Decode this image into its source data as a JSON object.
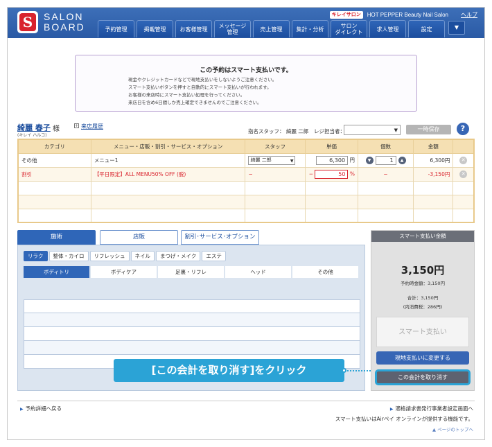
{
  "header": {
    "logo_line1": "SALON",
    "logo_line2": "BOARD",
    "logo_mark": "S",
    "brand_badge": "キレイサロン",
    "brand_name": "HOT PEPPER Beauty Nail Salon",
    "help": "ヘルプ",
    "nav": [
      "予約管理",
      "掲載管理",
      "お客様管理",
      "メッセージ\n管理",
      "売上管理",
      "集計・分析",
      "サロン\nダイレクト",
      "求人管理",
      "設定"
    ],
    "menu_icon": "▼"
  },
  "notice": {
    "title": "この予約はスマート支払いです。",
    "lines": [
      "現金やクレジットカードなどで現地支払いをしないようご注意ください。",
      "スマート支払いボタンを押すと自動的にスマート支払いが行われます。",
      "お客様の来店時にスマート支払い処理を行ってください。",
      "来店日を含め6日間しか売上確定できませんのでご注意ください。"
    ]
  },
  "customer": {
    "name": "綺麗 春子",
    "honorific": "様",
    "kana": "(キレイ ハルコ)",
    "history_link": "来店履歴",
    "staff_label": "指名スタッフ： 綺麗 二郎",
    "register_label": "レジ担当者：",
    "register_value": "",
    "hold_button": "一時保存",
    "help_icon": "?"
  },
  "table": {
    "headers": [
      "カテゴリ",
      "メニュー・店販・割引・サービス・オプション",
      "スタッフ",
      "単価",
      "個数",
      "金額",
      ""
    ],
    "rows": [
      {
        "category": "その他",
        "item": "メニュー1",
        "staff": "綺麗 二郎",
        "price": "6,300",
        "price_unit": "円",
        "qty": "1",
        "amount": "6,300円"
      },
      {
        "category": "割引",
        "item": "【平日限定】ALL MENU50% OFF (脱)",
        "staff": "−",
        "price_prefix": "−",
        "price": "50",
        "price_unit": "%",
        "qty": "−",
        "amount": "-3,150円"
      }
    ]
  },
  "tabs": [
    "施術",
    "店販",
    "割引･サービス･オプション"
  ],
  "categories": [
    "リラク",
    "整体・カイロ",
    "リフレッシュ",
    "ネイル",
    "まつげ・メイク",
    "エステ"
  ],
  "subcategories": [
    "ボディトリ",
    "ボディケア",
    "足裏・リフレ",
    "ヘッド",
    "その他"
  ],
  "smart_pay": {
    "header": "スマート支払い金額",
    "amount": "3,150円",
    "booked": "予約時金額：3,150円",
    "total": "合計：3,150円",
    "tax": "(内消費税：286円)",
    "pay_button": "スマート支払い",
    "onsite_button": "現地支払いに変更する",
    "cancel_button": "この会計を取り消す"
  },
  "callout": "[この会計を取り消す]をクリック",
  "footer": {
    "back": "予約詳細へ戻る",
    "invoice": "適格請求書発行事業者設定画面へ",
    "airpay_note": "スマート支払いはAirペイ オンラインが提供する機能です。",
    "page_top": "ページのトップへ"
  },
  "colors": {
    "header_blue": "#2a5aa5",
    "accent_blue": "#2f66b8",
    "callout_cyan": "#2ba3d6",
    "discount_red": "#d9232d",
    "table_header": "#f5e0b3"
  }
}
